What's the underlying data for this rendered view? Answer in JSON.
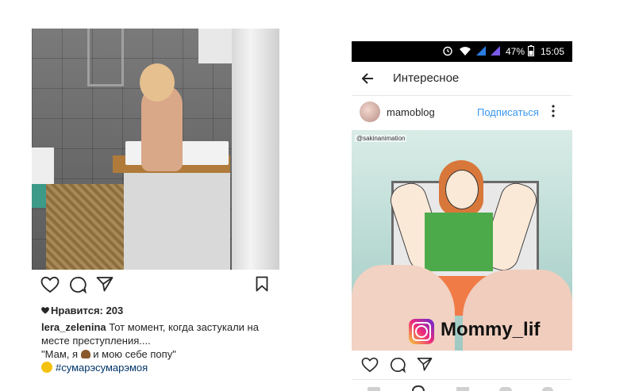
{
  "left_post": {
    "likes_label": "Нравится: 203",
    "caption_user": "lera_zelenina",
    "caption_text": " Тот момент, когда застукали на месте преступления....",
    "caption_quote_before": "\"Мам, я ",
    "caption_quote_after": " и мою себе попу\"",
    "hashtag": "#сумарэсумарэмоя",
    "icons": [
      "heart-icon",
      "comment-icon",
      "share-icon",
      "bookmark-icon"
    ]
  },
  "phone": {
    "status": {
      "battery": "47%",
      "time": "15:05",
      "icons": [
        "alarm-icon",
        "wifi-icon",
        "signal-icon",
        "battery-icon"
      ]
    },
    "app_bar": {
      "title": "Интересное"
    },
    "post": {
      "username": "mamoblog",
      "follow_label": "Подписаться",
      "video_watermark": "@sakinanimation",
      "brand_overlay": "Mommy_lif"
    }
  },
  "colors": {
    "follow_blue": "#3897f0",
    "hashtag_blue": "#003569",
    "status_bar": "#000000"
  }
}
